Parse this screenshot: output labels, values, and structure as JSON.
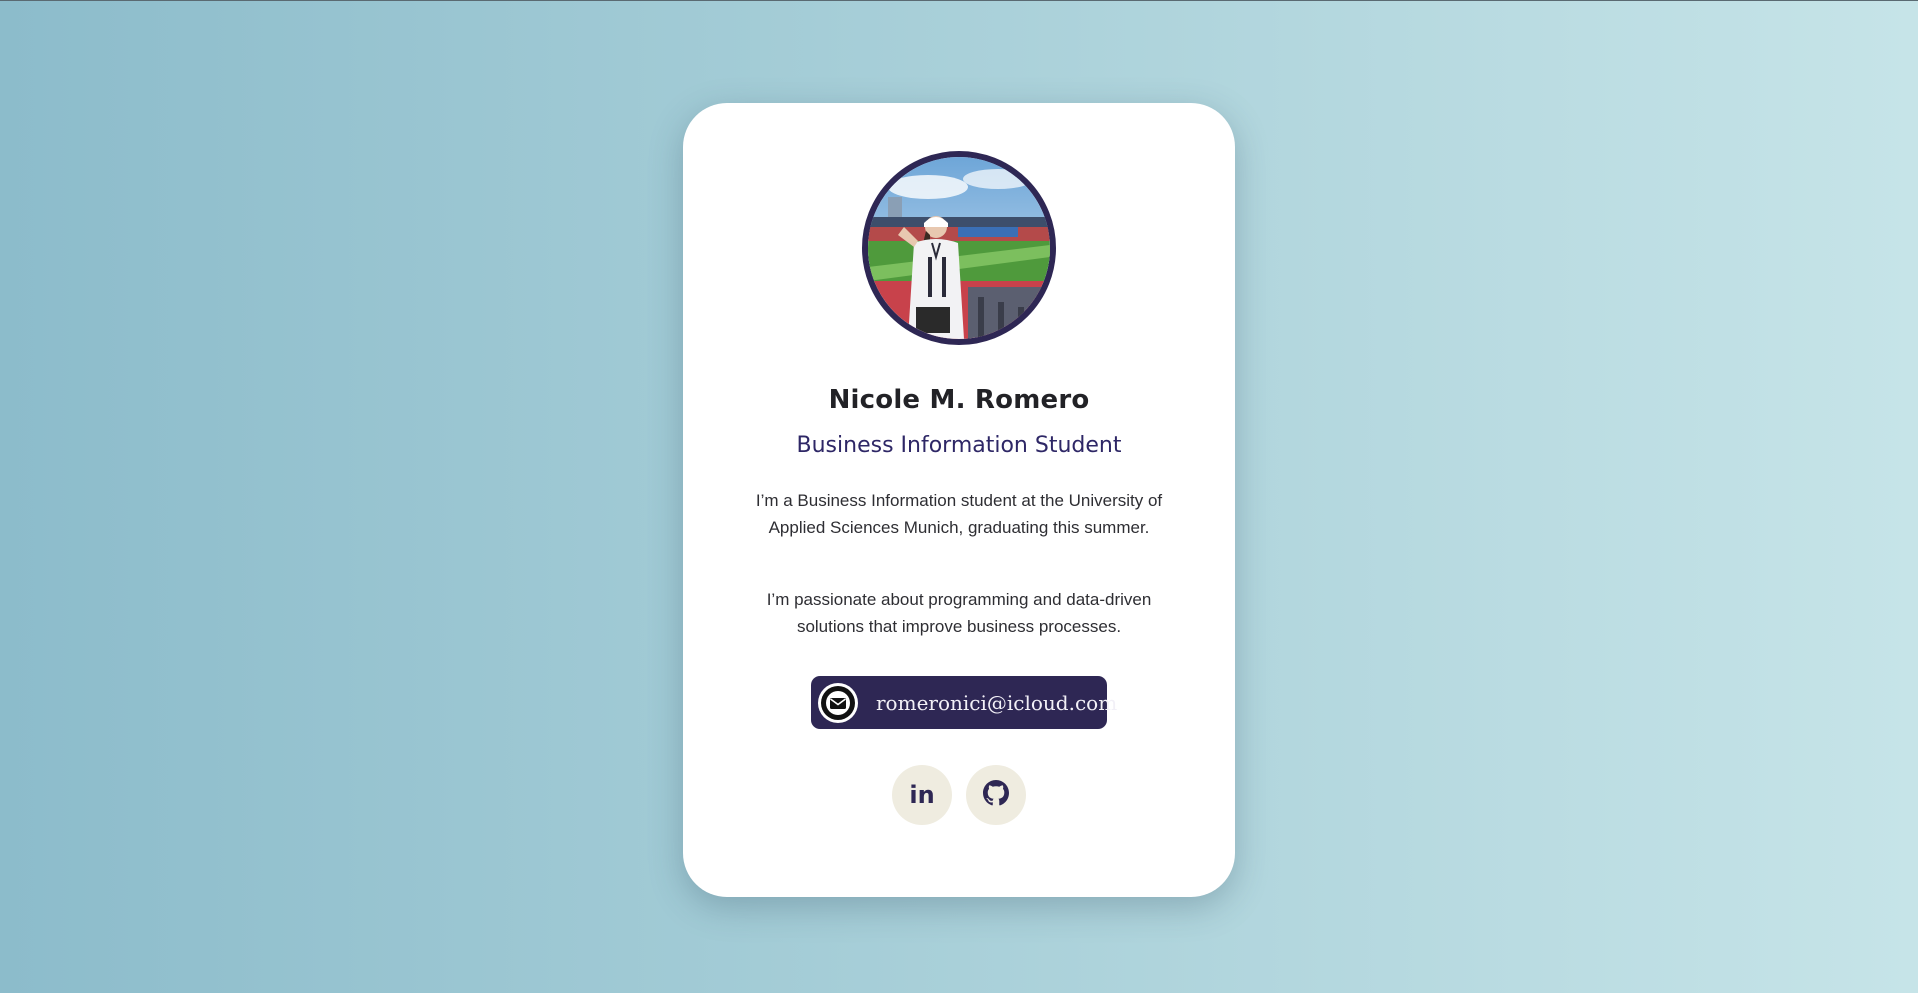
{
  "profile": {
    "name": "Nicole M. Romero",
    "role": "Business Information Student",
    "bio": [
      "I’m a Business Information student at the University of Applied Sciences Munich, graduating this summer.",
      "I’m passionate about programming and data-driven solutions that improve business processes."
    ]
  },
  "contact": {
    "email": "romeronici@icloud.com",
    "icon": "envelope-icon"
  },
  "social": [
    {
      "name": "LinkedIn",
      "icon": "linkedin-icon",
      "glyph": "in"
    },
    {
      "name": "GitHub",
      "icon": "github-icon"
    }
  ],
  "colors": {
    "accent": "#2e2754",
    "background_start": "#8cbccb",
    "background_end": "#c6e4e8",
    "card": "#ffffff",
    "social_bg": "#efece0"
  }
}
